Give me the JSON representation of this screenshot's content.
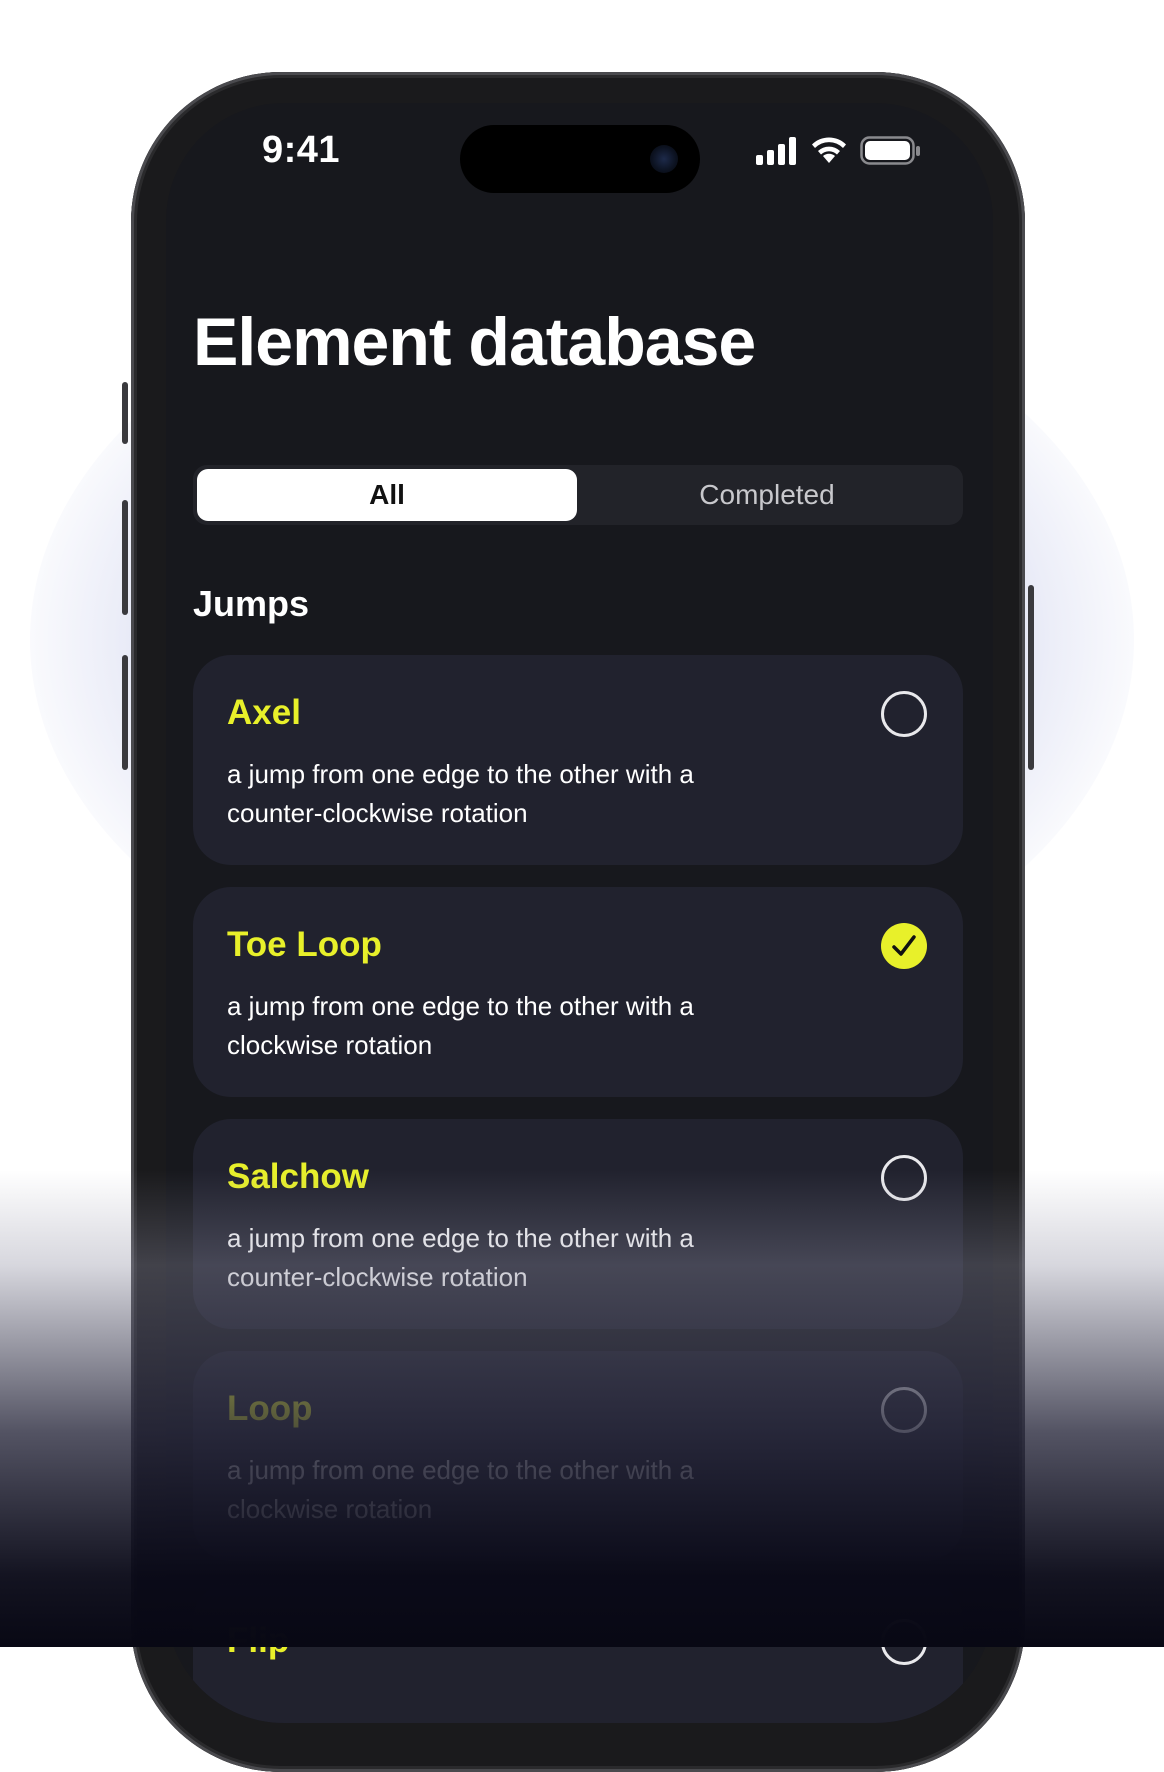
{
  "status_bar": {
    "time": "9:41",
    "icons": [
      "cellular-signal-icon",
      "wifi-icon",
      "battery-icon"
    ]
  },
  "header": {
    "title": "Element database"
  },
  "segmented_control": {
    "tabs": [
      {
        "label": "All",
        "selected": true
      },
      {
        "label": "Completed",
        "selected": false
      }
    ]
  },
  "section": {
    "title": "Jumps"
  },
  "elements": [
    {
      "name": "Axel",
      "description": "a jump from one edge to the other with a counter-clockwise rotation",
      "completed": false
    },
    {
      "name": "Toe Loop",
      "description": "a jump from one edge to the other with a clockwise rotation",
      "completed": true
    },
    {
      "name": "Salchow",
      "description": "a jump from one edge to the other with a counter-clockwise rotation",
      "completed": false
    },
    {
      "name": "Loop",
      "description": "a jump from one edge to the other with a clockwise rotation",
      "completed": false
    },
    {
      "name": "Flip",
      "description": "",
      "completed": false
    }
  ],
  "colors": {
    "accent": "#E8F02A",
    "screen_background": "#17181D",
    "card_background": "#21222E",
    "text_primary": "#FFFFFF"
  }
}
